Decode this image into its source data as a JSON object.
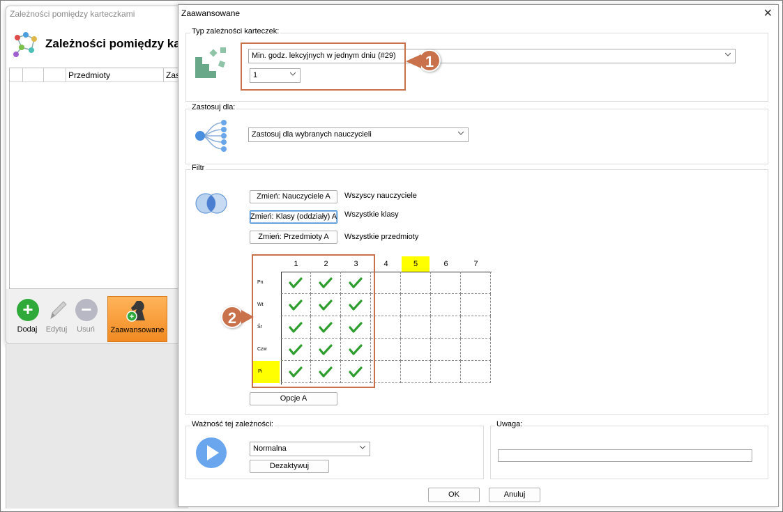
{
  "background_window": {
    "title": "Zależności pomiędzy karteczkami",
    "heading": "Zależności pomiędzy kar",
    "columns": [
      "",
      "",
      "Przedmioty",
      "Zas"
    ],
    "toolbar": [
      {
        "label": "Dodaj"
      },
      {
        "label": "Edytuj"
      },
      {
        "label": "Usuń"
      },
      {
        "label": "Zaawansowane"
      }
    ]
  },
  "dialog": {
    "title": "Zaawansowane",
    "type_group": {
      "label": "Typ zależności karteczek:",
      "selected": "Min. godz. lekcyjnych w jednym dniu (#29)",
      "value": "1",
      "badge": "1"
    },
    "apply_group": {
      "label": "Zastosuj dla:",
      "selected": "Zastosuj dla wybranych nauczycieli"
    },
    "filter_group": {
      "label": "Filtr",
      "rows": [
        {
          "button": "Zmień: Nauczyciele A",
          "text": "Wszyscy nauczyciele"
        },
        {
          "button": "Zmień: Klasy (oddziały) A",
          "text": "Wszystkie klasy"
        },
        {
          "button": "Zmień: Przedmioty A",
          "text": "Wszystkie przedmioty"
        }
      ],
      "grid": {
        "columns": [
          "1",
          "2",
          "3",
          "4",
          "5",
          "6",
          "7"
        ],
        "highlighted_column": "5",
        "days": [
          "Pn",
          "Wt",
          "Śr",
          "Czw",
          "Pi"
        ],
        "highlighted_day": "Pi",
        "checked_columns": [
          "1",
          "2",
          "3"
        ]
      },
      "options_button": "Opcje A",
      "badge": "2"
    },
    "importance_group": {
      "label": "Ważność tej zależności:",
      "selected": "Normalna",
      "deactivate_button": "Dezaktywuj"
    },
    "note_group": {
      "label": "Uwaga:",
      "value": ""
    },
    "ok_button": "OK",
    "cancel_button": "Anuluj"
  },
  "colors": {
    "annotation": "#c9714a",
    "highlight": "#ffff00",
    "check": "#2e9e2e",
    "accent_orange": "#f28a22"
  }
}
